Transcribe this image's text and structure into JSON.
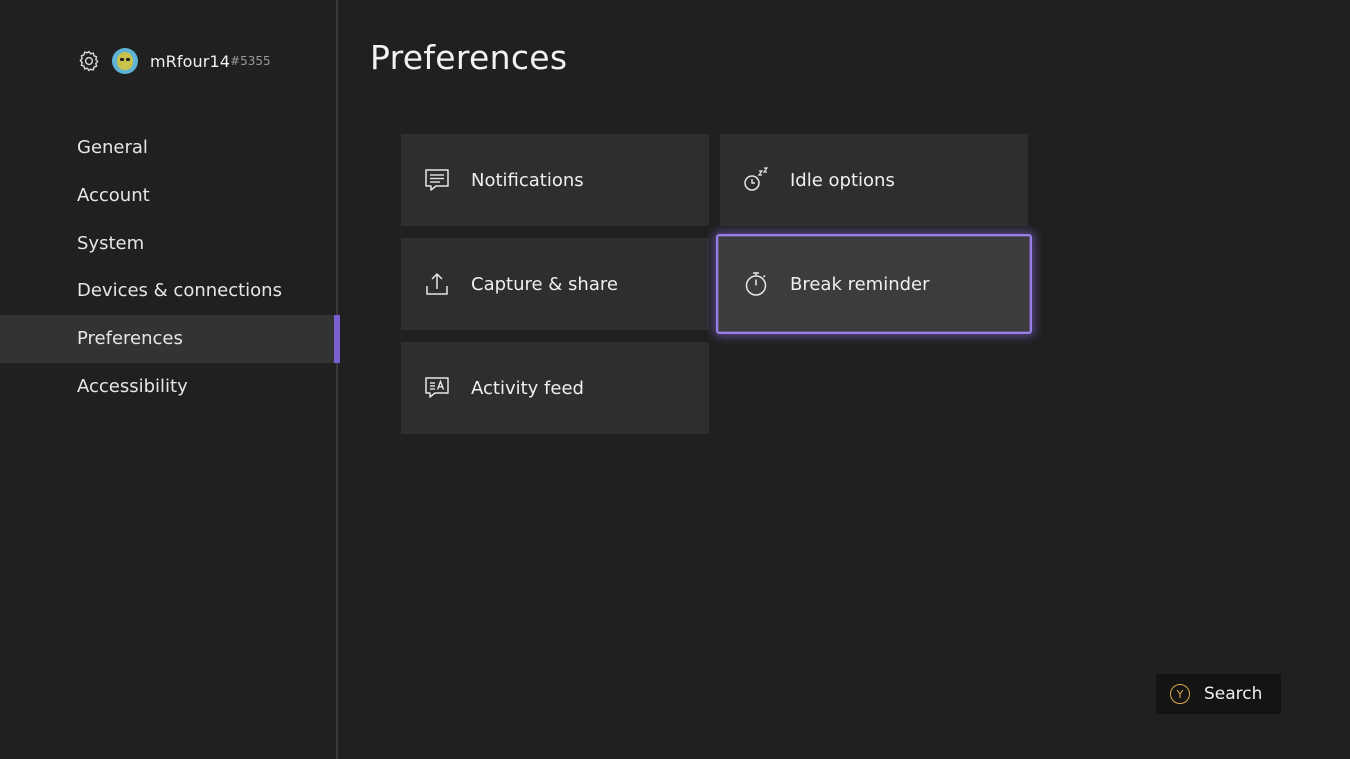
{
  "profile": {
    "gamertag": "mRfour14",
    "suffix": "#5355"
  },
  "sidebar": {
    "items": [
      {
        "label": "General"
      },
      {
        "label": "Account"
      },
      {
        "label": "System"
      },
      {
        "label": "Devices & connections"
      },
      {
        "label": "Preferences",
        "selected": true
      },
      {
        "label": "Accessibility"
      }
    ]
  },
  "main": {
    "title": "Preferences",
    "tiles": [
      {
        "label": "Notifications",
        "icon": "notifications-icon"
      },
      {
        "label": "Idle options",
        "icon": "idle-clock-icon"
      },
      {
        "label": "Capture & share",
        "icon": "upload-share-icon"
      },
      {
        "label": "Break reminder",
        "icon": "stopwatch-icon",
        "focused": true
      },
      {
        "label": "Activity feed",
        "icon": "activity-feed-icon"
      }
    ]
  },
  "footer": {
    "search_button": {
      "badge": "Y",
      "label": "Search"
    }
  },
  "colors": {
    "background": "#202020",
    "tile": "#2e2e2e",
    "accent": "#9a7ee8",
    "y_button": "#d8a84a"
  }
}
